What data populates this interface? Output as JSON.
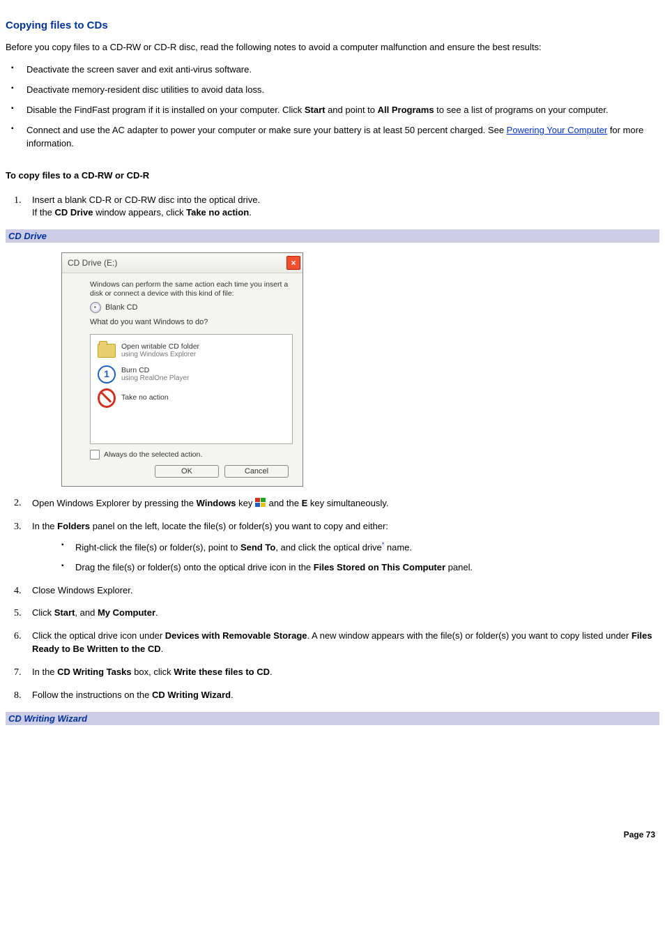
{
  "section_title": "Copying files to CDs",
  "intro": "Before you copy files to a CD-RW or CD-R disc, read the following notes to avoid a computer malfunction and ensure the best results:",
  "notes": {
    "n1": "Deactivate the screen saver and exit anti-virus software.",
    "n2": "Deactivate memory-resident disc utilities to avoid data loss.",
    "n3a": "Disable the FindFast program if it is installed on your computer. Click ",
    "n3b": " and point to ",
    "n3c": " to see a list of programs on your computer.",
    "n4a": "Connect and use the AC adapter to power your computer or make sure your battery is at least 50 percent charged. See ",
    "n4link": "Powering Your Computer",
    "n4b": " for more information."
  },
  "bold": {
    "start": "Start",
    "all_programs": "All Programs",
    "cd_drive": "CD Drive",
    "take_no_action": "Take no action",
    "windows": "Windows",
    "e": "E",
    "folders": "Folders",
    "send_to": "Send To",
    "files_stored": "Files Stored on This Computer",
    "my_computer": "My Computer",
    "devices": "Devices with Removable Storage",
    "files_ready": "Files Ready to Be Written to the CD",
    "cd_writing_tasks": "CD Writing Tasks",
    "write_these": "Write these files to CD",
    "cd_writing_wizard": "CD Writing Wizard"
  },
  "subheading": "To copy files to a CD-RW or CD-R",
  "steps": {
    "s1a": "Insert a blank CD-R or CD-RW disc into the optical drive.",
    "s1b_a": "If the ",
    "s1b_b": " window appears, click ",
    "s1b_c": ".",
    "s2a": "Open Windows Explorer by pressing the ",
    "s2b": " key ",
    "s2c": " and the ",
    "s2d": " key simultaneously.",
    "s3a": "In the ",
    "s3b": " panel on the left, locate the file(s) or folder(s) you want to copy and either:",
    "s3_sub1a": "Right-click the file(s) or folder(s), point to ",
    "s3_sub1b": ", and click the optical drive",
    "s3_sub1c": " name.",
    "s3_sub2a": "Drag the file(s) or folder(s) onto the optical drive icon in the ",
    "s3_sub2b": " panel.",
    "s4": "Close Windows Explorer.",
    "s5a": "Click ",
    "s5b": ", and ",
    "s5c": ".",
    "s6a": "Click the optical drive icon under ",
    "s6b": ". A new window appears with the file(s) or folder(s) you want to copy listed under ",
    "s6c": ".",
    "s7a": "In the ",
    "s7b": " box, click ",
    "s7c": ".",
    "s8a": "Follow the instructions on the ",
    "s8b": "."
  },
  "caption1": "CD Drive",
  "caption2": "CD Writing Wizard",
  "dialog": {
    "title": "CD Drive (E:)",
    "intro": "Windows can perform the same action each time you insert a disk or connect a device with this kind of file:",
    "blank": "Blank CD",
    "prompt": "What do you want Windows to do?",
    "opt1_main": "Open writable CD folder",
    "opt1_sub": "using Windows Explorer",
    "opt2_main": "Burn CD",
    "opt2_sub": "using RealOne Player",
    "opt3_main": "Take no action",
    "always": "Always do the selected action.",
    "ok": "OK",
    "cancel": "Cancel"
  },
  "page_num": "Page 73"
}
